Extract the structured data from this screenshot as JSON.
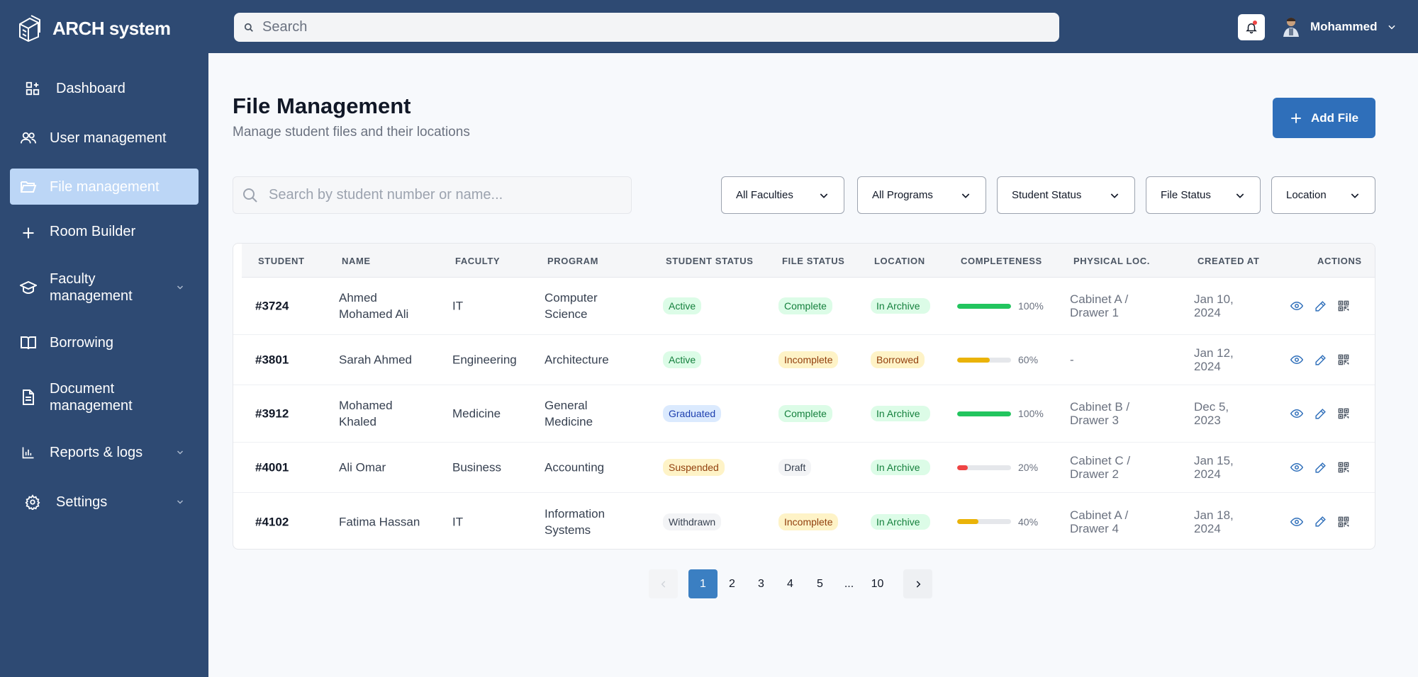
{
  "app": {
    "name": "ARCH system"
  },
  "topbar": {
    "search_placeholder": "Search",
    "user_name": "Mohammed"
  },
  "sidebar": {
    "items": [
      {
        "label": "Dashboard"
      },
      {
        "label": "User management"
      },
      {
        "label": "File management"
      },
      {
        "label": "Room Builder"
      },
      {
        "label": "Faculty management"
      },
      {
        "label": "Borrowing"
      },
      {
        "label": "Document management"
      },
      {
        "label": "Reports & logs"
      },
      {
        "label": "Settings"
      }
    ]
  },
  "page": {
    "title": "File Management",
    "subtitle": "Manage student files and their locations",
    "add_button": "Add File"
  },
  "filters": {
    "search_placeholder": "Search by student number or name...",
    "dropdowns": [
      "All Faculties",
      "All Programs",
      "Student Status",
      "File Status",
      "Location"
    ]
  },
  "table": {
    "columns": [
      "STUDENT",
      "NAME",
      "FACULTY",
      "PROGRAM",
      "STUDENT STATUS",
      "FILE STATUS",
      "LOCATION",
      "COMPLETENESS",
      "PHYSICAL LOC.",
      "CREATED AT",
      "ACTIONS"
    ],
    "rows": [
      {
        "id": "#3724",
        "name": "Ahmed Mohamed Ali",
        "faculty": "IT",
        "program": "Computer Science",
        "student_status": "Active",
        "file_status": "Complete",
        "location": "In Archive",
        "completeness": 100,
        "completeness_label": "100%",
        "physical": "Cabinet A / Drawer 1",
        "created": "Jan 10, 2024"
      },
      {
        "id": "#3801",
        "name": "Sarah Ahmed",
        "faculty": "Engineering",
        "program": "Architecture",
        "student_status": "Active",
        "file_status": "Incomplete",
        "location": "Borrowed",
        "completeness": 60,
        "completeness_label": "60%",
        "physical": "-",
        "created": "Jan 12, 2024"
      },
      {
        "id": "#3912",
        "name": "Mohamed Khaled",
        "faculty": "Medicine",
        "program": "General Medicine",
        "student_status": "Graduated",
        "file_status": "Complete",
        "location": "In Archive",
        "completeness": 100,
        "completeness_label": "100%",
        "physical": "Cabinet B / Drawer 3",
        "created": "Dec 5, 2023"
      },
      {
        "id": "#4001",
        "name": "Ali Omar",
        "faculty": "Business",
        "program": "Accounting",
        "student_status": "Suspended",
        "file_status": "Draft",
        "location": "In Archive",
        "completeness": 20,
        "completeness_label": "20%",
        "physical": "Cabinet C / Drawer 2",
        "created": "Jan 15, 2024"
      },
      {
        "id": "#4102",
        "name": "Fatima Hassan",
        "faculty": "IT",
        "program": "Information Systems",
        "student_status": "Withdrawn",
        "file_status": "Incomplete",
        "location": "In Archive",
        "completeness": 40,
        "completeness_label": "40%",
        "physical": "Cabinet A / Drawer 4",
        "created": "Jan 18, 2024"
      }
    ]
  },
  "pagination": {
    "pages": [
      "1",
      "2",
      "3",
      "4",
      "5",
      "...",
      "10"
    ],
    "current": "1"
  },
  "colors": {
    "navy": "#2e4a73",
    "primary": "#2f6fba",
    "active_nav": "#bcd6f6",
    "green": "#22c55e",
    "amber": "#eab308",
    "red": "#ef4444"
  }
}
